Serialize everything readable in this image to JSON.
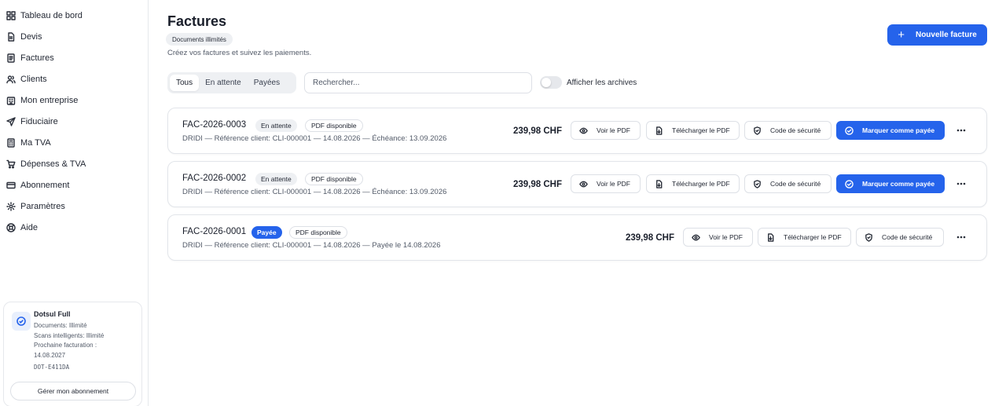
{
  "sidebar": {
    "items": [
      {
        "label": "Tableau de bord",
        "icon": "dashboard-icon"
      },
      {
        "label": "Devis",
        "icon": "document-icon"
      },
      {
        "label": "Factures",
        "icon": "invoice-icon"
      },
      {
        "label": "Clients",
        "icon": "users-icon"
      },
      {
        "label": "Mon entreprise",
        "icon": "building-icon"
      },
      {
        "label": "Fiduciaire",
        "icon": "send-icon"
      },
      {
        "label": "Ma TVA",
        "icon": "calculator-icon"
      },
      {
        "label": "Dépenses & TVA",
        "icon": "cart-icon"
      },
      {
        "label": "Abonnement",
        "icon": "card-icon"
      },
      {
        "label": "Paramètres",
        "icon": "gear-icon"
      },
      {
        "label": "Aide",
        "icon": "help-icon"
      }
    ],
    "plan": {
      "name": "Dotsul Full",
      "documents": "Documents: Illimité",
      "scans": "Scans intelligents: Illimité",
      "next_billing_label": "Prochaine facturation :",
      "next_billing_date": "14.08.2027",
      "code": "DOT-E411DA",
      "manage_label": "Gérer mon abonnement"
    }
  },
  "header": {
    "title": "Factures",
    "chip": "Documents illimités",
    "subtitle": "Créez vos factures et suivez les paiements.",
    "new_button": "Nouvelle facture"
  },
  "filters": {
    "tabs": [
      "Tous",
      "En attente",
      "Payées"
    ],
    "active_tab": "Tous",
    "search_placeholder": "Rechercher...",
    "archives_label": "Afficher les archives",
    "archives_on": false
  },
  "actions": {
    "view": "Voir le PDF",
    "download": "Télécharger le PDF",
    "security": "Code de sécurité",
    "mark_paid": "Marquer comme payée"
  },
  "invoices": [
    {
      "number": "FAC-2026-0003",
      "status": "En attente",
      "pdf": "PDF disponible",
      "meta": "DRIDI — Référence client: CLI-000001 — 14.08.2026 — Échéance: 13.09.2026",
      "amount": "239,98 CHF"
    },
    {
      "number": "FAC-2026-0002",
      "status": "En attente",
      "pdf": "PDF disponible",
      "meta": "DRIDI — Référence client: CLI-000001 — 14.08.2026 — Échéance: 13.09.2026",
      "amount": "239,98 CHF"
    },
    {
      "number": "FAC-2026-0001",
      "status": "Payée",
      "pdf": "PDF disponible",
      "meta": "DRIDI — Référence client: CLI-000001 — 14.08.2026 — Payée le 14.08.2026",
      "amount": "239,98 CHF"
    }
  ],
  "colors": {
    "accent": "#2563eb",
    "border": "#e2e5ea",
    "muted_text": "#525a68"
  }
}
